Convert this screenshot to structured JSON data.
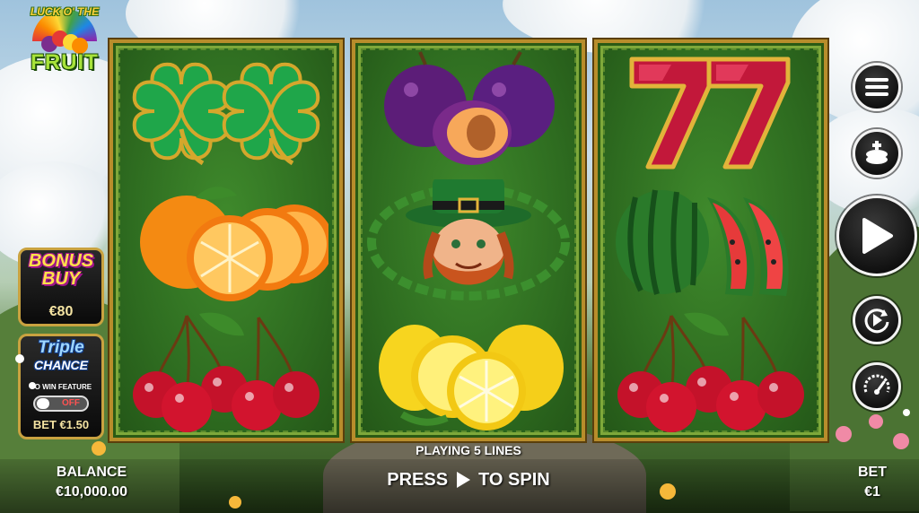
{
  "logo": {
    "line1": "LUCK O' THE",
    "line2": "FRUIT"
  },
  "reels": [
    {
      "symbols": [
        "clover-double",
        "orange",
        "cherries"
      ]
    },
    {
      "symbols": [
        "plums",
        "leprechaun",
        "lemons"
      ]
    },
    {
      "symbols": [
        "double-seven",
        "watermelon",
        "cherries"
      ]
    }
  ],
  "bonus_buy": {
    "title": "BONUS BUY",
    "price": "€80"
  },
  "triple_chance": {
    "title_line1": "Triple",
    "title_line2": "CHANCE",
    "subtitle": "TO WIN FEATURE",
    "toggle_state": "OFF",
    "bet_label": "BET €1.50"
  },
  "lines_text": "PLAYING 5 LINES",
  "balance": {
    "label": "BALANCE",
    "value": "€10,000.00"
  },
  "spin_prompt": {
    "before": "PRESS",
    "after": "TO SPIN"
  },
  "bet": {
    "label": "BET",
    "value": "€1"
  },
  "side_buttons": [
    "menu-icon",
    "coin-stack-icon",
    "play-icon",
    "autoplay-icon",
    "speed-gauge-icon"
  ],
  "colors": {
    "reel_bg": "#2e6c20",
    "frame_gold": "#b88d2b",
    "button_dark": "#111111",
    "toggle_off": "#ff5252"
  }
}
